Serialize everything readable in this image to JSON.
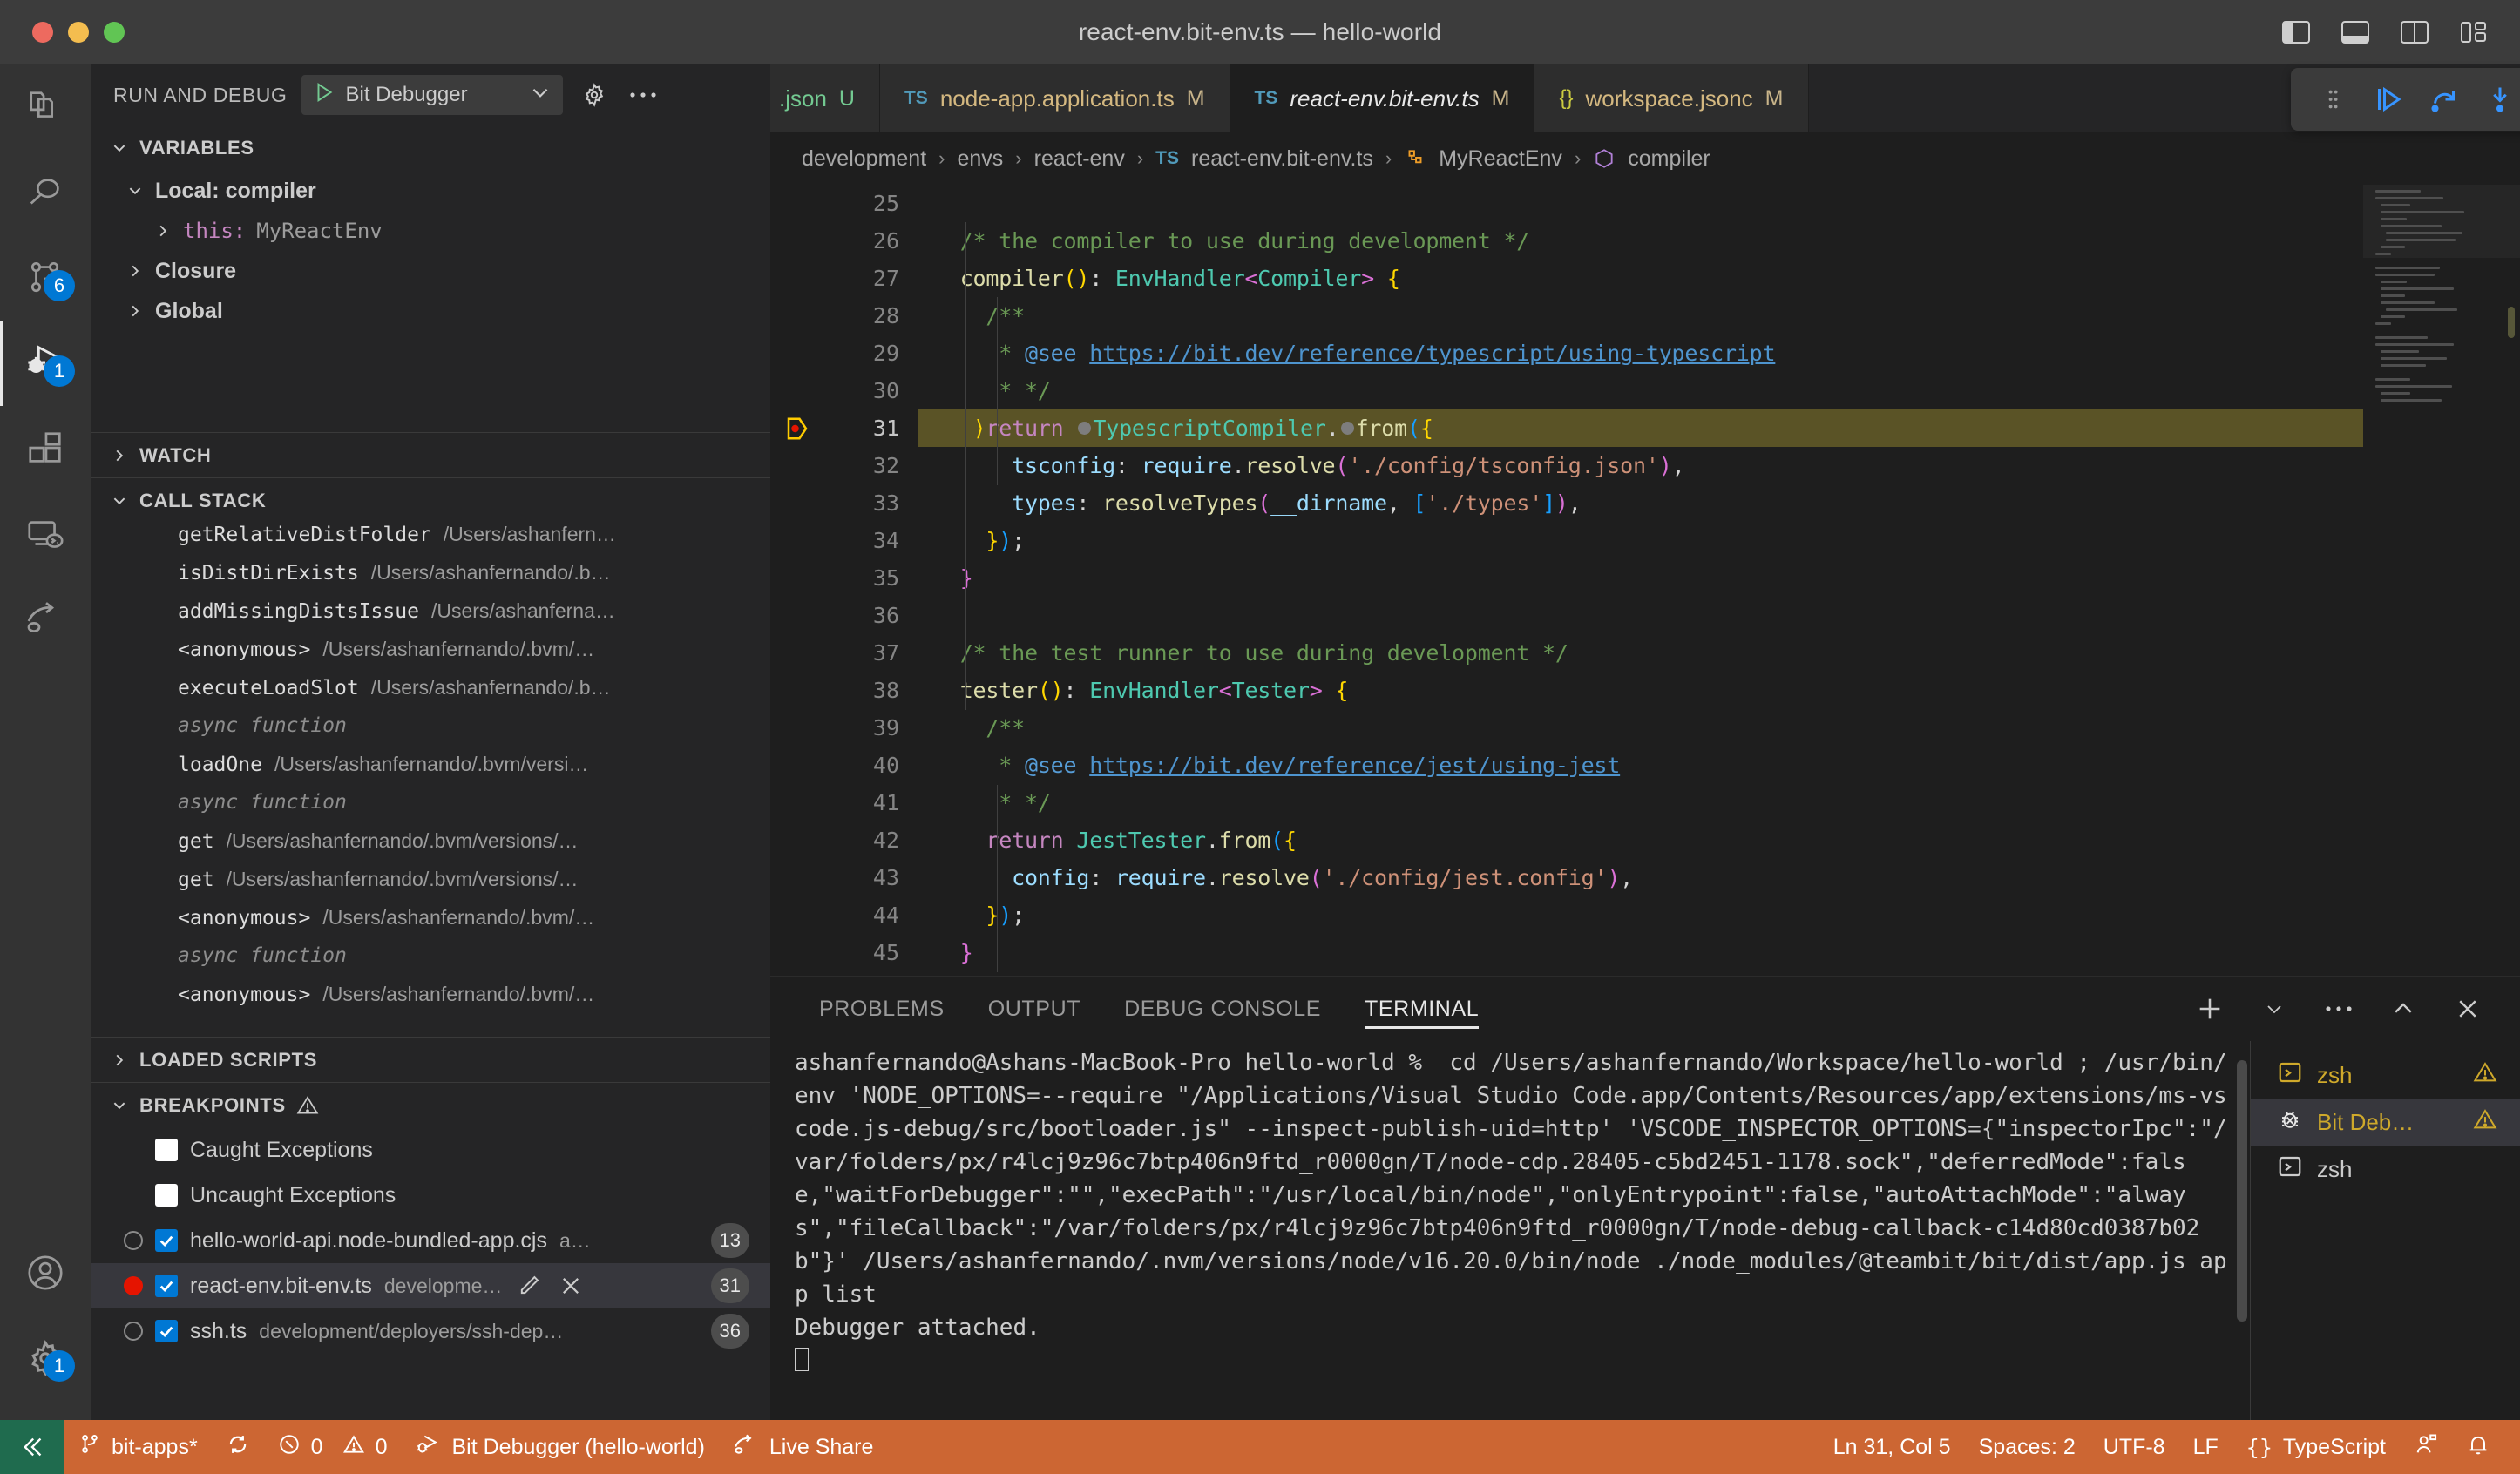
{
  "window": {
    "title": "react-env.bit-env.ts — hello-world",
    "layout_icons": [
      "toggle-primary-sidebar",
      "toggle-panel",
      "toggle-secondary-sidebar",
      "customize-layout"
    ]
  },
  "activity_bar": {
    "items": [
      {
        "name": "explorer",
        "icon": "files-icon",
        "badge": null,
        "active": false
      },
      {
        "name": "search",
        "icon": "search-icon",
        "badge": null,
        "active": false
      },
      {
        "name": "source-control",
        "icon": "source-control-icon",
        "badge": "6",
        "active": false
      },
      {
        "name": "run-and-debug",
        "icon": "debug-icon",
        "badge": "1",
        "active": true
      },
      {
        "name": "extensions",
        "icon": "extensions-icon",
        "badge": null,
        "active": false
      },
      {
        "name": "remote-explorer",
        "icon": "remote-icon",
        "badge": null,
        "active": false
      },
      {
        "name": "live-share",
        "icon": "live-share-icon",
        "badge": null,
        "active": false
      }
    ],
    "bottom": [
      {
        "name": "accounts",
        "icon": "account-icon",
        "badge": null
      },
      {
        "name": "manage",
        "icon": "gear-icon",
        "badge": "1"
      }
    ]
  },
  "sidebar": {
    "header": {
      "title": "RUN AND DEBUG",
      "configuration": "Bit Debugger",
      "start_icon": "play-icon",
      "dropdown_icon": "chevron-down-icon",
      "settings_icon": "gear-icon",
      "more_icon": "ellipsis-icon"
    },
    "variables": {
      "title": "VARIABLES",
      "expanded": true,
      "scopes": [
        {
          "label": "Local: compiler",
          "expanded": true
        },
        {
          "label": "Closure",
          "expanded": false
        },
        {
          "label": "Global",
          "expanded": false
        }
      ],
      "entries": [
        {
          "name": "this:",
          "value": "MyReactEnv"
        }
      ]
    },
    "watch": {
      "title": "WATCH",
      "expanded": false
    },
    "call_stack": {
      "title": "CALL STACK",
      "expanded": true,
      "frames": [
        {
          "fn": "getRelativeDistFolder",
          "path": "/Users/ashanfern…",
          "async": false
        },
        {
          "fn": "isDistDirExists",
          "path": "/Users/ashanfernando/.b…",
          "async": false
        },
        {
          "fn": "addMissingDistsIssue",
          "path": "/Users/ashanferna…",
          "async": false
        },
        {
          "fn": "<anonymous>",
          "path": "/Users/ashanfernando/.bvm/…",
          "async": false
        },
        {
          "fn": "executeLoadSlot",
          "path": "/Users/ashanfernando/.b…",
          "async": false
        },
        {
          "fn": "async function",
          "path": "",
          "async": true
        },
        {
          "fn": "loadOne",
          "path": "/Users/ashanfernando/.bvm/versi…",
          "async": false
        },
        {
          "fn": "async function",
          "path": "",
          "async": true
        },
        {
          "fn": "get",
          "path": "/Users/ashanfernando/.bvm/versions/…",
          "async": false
        },
        {
          "fn": "get",
          "path": "/Users/ashanfernando/.bvm/versions/…",
          "async": false
        },
        {
          "fn": "<anonymous>",
          "path": "/Users/ashanfernando/.bvm/…",
          "async": false
        },
        {
          "fn": "async function",
          "path": "",
          "async": true
        },
        {
          "fn": "<anonymous>",
          "path": "/Users/ashanfernando/.bvm/…",
          "async": false
        }
      ]
    },
    "loaded_scripts": {
      "title": "LOADED SCRIPTS",
      "expanded": false
    },
    "breakpoints": {
      "title": "BREAKPOINTS",
      "expanded": true,
      "warning_icon": "warning-triangle-icon",
      "exception_options": [
        {
          "label": "Caught Exceptions",
          "checked": false
        },
        {
          "label": "Uncaught Exceptions",
          "checked": false
        }
      ],
      "items": [
        {
          "file": "hello-world-api.node-bundled-app.cjs",
          "path": "a…",
          "line": "13",
          "checked": true,
          "verified": false,
          "selected": false
        },
        {
          "file": "react-env.bit-env.ts",
          "path": "developme…",
          "line": "31",
          "checked": true,
          "verified": true,
          "selected": true,
          "actions": [
            "edit-icon",
            "remove-icon"
          ]
        },
        {
          "file": "ssh.ts",
          "path": "development/deployers/ssh-dep…",
          "line": "36",
          "checked": true,
          "verified": false,
          "selected": false
        }
      ]
    }
  },
  "editor": {
    "tabs": [
      {
        "label": ".json",
        "icon": "json-icon",
        "badge": "U",
        "badge_kind": "untracked",
        "active": false,
        "partial": true
      },
      {
        "label": "node-app.application.ts",
        "icon": "ts-icon",
        "badge": "M",
        "badge_kind": "modified",
        "active": false
      },
      {
        "label": "react-env.bit-env.ts",
        "icon": "ts-icon",
        "badge": "M",
        "badge_kind": "modified",
        "active": true
      },
      {
        "label": "workspace.jsonc",
        "icon": "jsonc-icon",
        "badge": "M",
        "badge_kind": "modified",
        "active": false
      }
    ],
    "tab_actions": [
      "split-editor-icon",
      "more-actions-icon"
    ],
    "debug_toolbar": {
      "buttons": [
        {
          "name": "drag-handle",
          "icon": "grip-icon"
        },
        {
          "name": "continue",
          "icon": "continue-icon"
        },
        {
          "name": "step-over",
          "icon": "step-over-icon"
        },
        {
          "name": "step-into",
          "icon": "step-into-icon"
        },
        {
          "name": "step-out",
          "icon": "step-out-icon"
        },
        {
          "name": "restart",
          "icon": "restart-icon"
        },
        {
          "name": "stop",
          "icon": "stop-icon"
        }
      ]
    },
    "breadcrumb": [
      "development",
      "envs",
      "react-env",
      "react-env.bit-env.ts",
      "MyReactEnv",
      "compiler"
    ],
    "breadcrumb_icons": {
      "file": "ts-icon",
      "class": "class-icon",
      "method": "method-icon"
    },
    "first_line": 25,
    "current_line": 31,
    "lines": [
      {
        "n": 25,
        "text": ""
      },
      {
        "n": 26,
        "text": "  /* the compiler to use during development */"
      },
      {
        "n": 27,
        "text": "  compiler(): EnvHandler<Compiler> {"
      },
      {
        "n": 28,
        "text": "    /**"
      },
      {
        "n": 29,
        "text": "     * @see https://bit.dev/reference/typescript/using-typescript"
      },
      {
        "n": 30,
        "text": "     * */"
      },
      {
        "n": 31,
        "text": "    return TypescriptCompiler.from({"
      },
      {
        "n": 32,
        "text": "      tsconfig: require.resolve('./config/tsconfig.json'),"
      },
      {
        "n": 33,
        "text": "      types: resolveTypes(__dirname, ['./types']),"
      },
      {
        "n": 34,
        "text": "    });"
      },
      {
        "n": 35,
        "text": "  }"
      },
      {
        "n": 36,
        "text": ""
      },
      {
        "n": 37,
        "text": "  /* the test runner to use during development */"
      },
      {
        "n": 38,
        "text": "  tester(): EnvHandler<Tester> {"
      },
      {
        "n": 39,
        "text": "    /**"
      },
      {
        "n": 40,
        "text": "     * @see https://bit.dev/reference/jest/using-jest"
      },
      {
        "n": 41,
        "text": "     * */"
      },
      {
        "n": 42,
        "text": "    return JestTester.from({"
      },
      {
        "n": 43,
        "text": "      config: require.resolve('./config/jest.config'),"
      },
      {
        "n": 44,
        "text": "    });"
      },
      {
        "n": 45,
        "text": "  }"
      }
    ]
  },
  "panel": {
    "tabs": [
      {
        "label": "PROBLEMS",
        "active": false
      },
      {
        "label": "OUTPUT",
        "active": false
      },
      {
        "label": "DEBUG CONSOLE",
        "active": false
      },
      {
        "label": "TERMINAL",
        "active": true
      }
    ],
    "actions": [
      "add-terminal-icon",
      "split-dropdown-icon",
      "more-actions-icon",
      "maximize-panel-icon",
      "close-panel-icon"
    ],
    "terminal_output": "ashanfernando@Ashans-MacBook-Pro hello-world %  cd /Users/ashanfernando/Workspace/hello-world ; /usr/bin/env 'NODE_OPTIONS=--require \"/Applications/Visual Studio Code.app/Contents/Resources/app/extensions/ms-vscode.js-debug/src/bootloader.js\" --inspect-publish-uid=http' 'VSCODE_INSPECTOR_OPTIONS={\"inspectorIpc\":\"/var/folders/px/r4lcj9z96c7btp406n9ftd_r0000gn/T/node-cdp.28405-c5bd2451-1178.sock\",\"deferredMode\":false,\"waitForDebugger\":\"\",\"execPath\":\"/usr/local/bin/node\",\"onlyEntrypoint\":false,\"autoAttachMode\":\"always\",\"fileCallback\":\"/var/folders/px/r4lcj9z96c7btp406n9ftd_r0000gn/T/node-debug-callback-c14d80cd0387b02b\"}' /Users/ashanfernando/.nvm/versions/node/v16.20.0/bin/node ./node_modules/@teambit/bit/dist/app.js app list\nDebugger attached.\n",
    "terminal_list": [
      {
        "label": "zsh",
        "icon": "terminal-icon",
        "warning": true,
        "selected": false
      },
      {
        "label": "Bit Deb…",
        "icon": "debug-bug-icon",
        "warning": true,
        "selected": true
      },
      {
        "label": "zsh",
        "icon": "terminal-icon",
        "warning": false,
        "selected": false
      }
    ]
  },
  "status_bar": {
    "background": "#cc6633",
    "remote_icon": "remote-indicator-icon",
    "left": [
      {
        "name": "branch",
        "icon": "source-control-icon",
        "label": "bit-apps*"
      },
      {
        "name": "sync",
        "icon": "sync-icon",
        "label": ""
      },
      {
        "name": "problems",
        "icon": "error-icon",
        "label": "0",
        "icon2": "warning-icon",
        "label2": "0"
      },
      {
        "name": "debug-session",
        "icon": "debug-alt-icon",
        "label": "Bit Debugger (hello-world)"
      },
      {
        "name": "live-share",
        "icon": "live-share-icon",
        "label": "Live Share"
      }
    ],
    "right": [
      {
        "name": "cursor-position",
        "label": "Ln 31, Col 5"
      },
      {
        "name": "indentation",
        "label": "Spaces: 2"
      },
      {
        "name": "encoding",
        "label": "UTF-8"
      },
      {
        "name": "eol",
        "label": "LF"
      },
      {
        "name": "language-mode",
        "label": "TypeScript",
        "icon": "braces-icon"
      },
      {
        "name": "feedback",
        "icon": "feedback-icon",
        "label": ""
      },
      {
        "name": "notifications",
        "icon": "bell-icon",
        "label": ""
      }
    ]
  }
}
